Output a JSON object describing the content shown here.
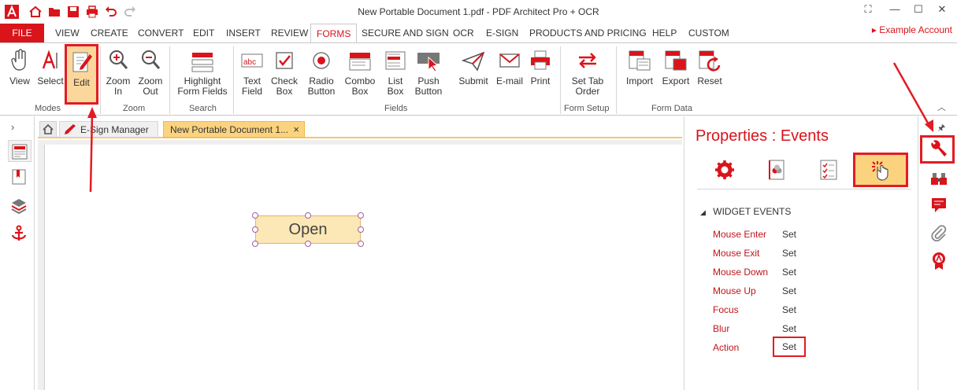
{
  "window": {
    "title": "New Portable Document 1.pdf   -   PDF Architect Pro + OCR"
  },
  "menu": {
    "file": "FILE",
    "items": [
      "VIEW",
      "CREATE",
      "CONVERT",
      "EDIT",
      "INSERT",
      "REVIEW",
      "FORMS",
      "SECURE AND SIGN",
      "OCR",
      "E-SIGN",
      "PRODUCTS AND PRICING",
      "HELP",
      "CUSTOM"
    ],
    "active": "FORMS",
    "account": "Example Account"
  },
  "ribbon": {
    "view": "View",
    "select": "Select",
    "edit": "Edit",
    "zoom_in": "Zoom\nIn",
    "zoom_out": "Zoom\nOut",
    "highlight": "Highlight\nForm Fields",
    "text_field": "Text\nField",
    "check_box": "Check\nBox",
    "radio_button": "Radio\nButton",
    "combo_box": "Combo\nBox",
    "list_box": "List\nBox",
    "push_button": "Push\nButton",
    "submit": "Submit",
    "email": "E-mail",
    "print": "Print",
    "set_tab_order": "Set Tab\nOrder",
    "import": "Import",
    "export": "Export",
    "reset": "Reset",
    "groups": {
      "modes": "Modes",
      "zoom": "Zoom",
      "search": "Search",
      "fields": "Fields",
      "form_setup": "Form Setup",
      "form_data": "Form Data"
    }
  },
  "tabs": {
    "esign": "E-Sign Manager",
    "doc": "New Portable Document 1...",
    "close": "×"
  },
  "document": {
    "button_text": "Open"
  },
  "properties": {
    "title": "Properties : Events",
    "section": "WIDGET EVENTS",
    "events": [
      {
        "name": "Mouse Enter",
        "value": "Set"
      },
      {
        "name": "Mouse Exit",
        "value": "Set"
      },
      {
        "name": "Mouse Down",
        "value": "Set"
      },
      {
        "name": "Mouse Up",
        "value": "Set"
      },
      {
        "name": "Focus",
        "value": "Set"
      },
      {
        "name": "Blur",
        "value": "Set"
      },
      {
        "name": "Action",
        "value": "Set"
      }
    ]
  },
  "colors": {
    "brand_red": "#d9141b",
    "highlight_orange": "#fbd37f",
    "annotation_red": "#e31b23"
  }
}
